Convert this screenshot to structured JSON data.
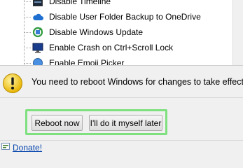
{
  "tree": {
    "items": [
      {
        "label": "Disable Timeline",
        "icon": "window-icon"
      },
      {
        "label": "Disable User Folder Backup to OneDrive",
        "icon": "onedrive-cloud-icon"
      },
      {
        "label": "Disable Windows Update",
        "icon": "windows-update-icon"
      },
      {
        "label": "Enable Crash on Ctrl+Scroll Lock",
        "icon": "monitor-icon"
      },
      {
        "label": "Enable Emoji Picker",
        "icon": "emoji-picker-icon"
      }
    ]
  },
  "dialog": {
    "message": "You need to reboot Windows for changes to take effect.",
    "reboot_label": "Reboot now",
    "later_label": "I'll do it myself later"
  },
  "footer": {
    "donate_label": "Donate!"
  },
  "colors": {
    "highlight": "#7ee07e",
    "link": "#0645ad",
    "warning_yellow": "#f5d23a"
  }
}
